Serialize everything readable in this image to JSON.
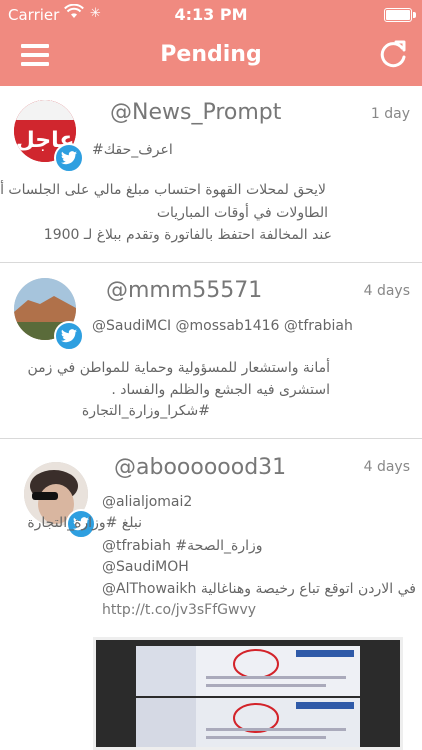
{
  "status_bar": {
    "carrier": "Carrier",
    "time": "4:13 PM"
  },
  "nav": {
    "title": "Pending"
  },
  "colors": {
    "header": "#f08a80",
    "twitter": "#2e9fe0"
  },
  "tweets": [
    {
      "handle": "@News_Prompt",
      "time": "1 day",
      "avatar_text": "عاجل",
      "lines": [
        "#اعرف_حقك",
        "لايحق لمحلات القهوة احتساب مبلغ مالي على الجلسات أو",
        "الطاولات في أوقات المباريات",
        "عند المخالفة احتفظ بالفاتورة وتقدم ببلاغ لـ 1900"
      ]
    },
    {
      "handle": "@mmm55571",
      "time": "4 days",
      "lines": [
        "@SaudiMCI @mossab1416 @tfrabiah",
        "أمانة واستشعار للمسؤولية وحماية للمواطن في زمن",
        "استشرى فيه الجشع والظلم والفساد .",
        "#شكرا_وزارة_التجارة"
      ]
    },
    {
      "handle": "@abooooood31",
      "time": "4 days",
      "lines": [
        "@alialjomai2",
        "نبلغ #وزارة_التجارة",
        "@tfrabiah #وزارة_الصحة",
        "@SaudiMOH",
        "@AlThowaikh في الاردن اتوقع تباع رخيصة وهناغالية",
        "http://t.co/jv3sFfGwvy"
      ]
    }
  ]
}
